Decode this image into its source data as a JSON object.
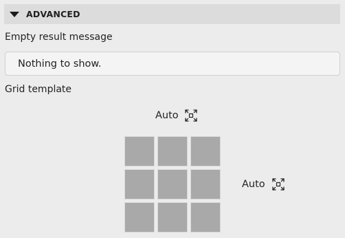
{
  "section": {
    "title": "ADVANCED"
  },
  "empty_result": {
    "label": "Empty result message",
    "value": "Nothing to show."
  },
  "grid_template": {
    "label": "Grid template",
    "columns_label": "Auto",
    "rows_label": "Auto",
    "columns_icon": "expand-icon",
    "rows_icon": "expand-icon",
    "cells": [
      {
        "name": "cell-1"
      },
      {
        "name": "cell-2"
      },
      {
        "name": "cell-3"
      },
      {
        "name": "cell-4"
      },
      {
        "name": "cell-5"
      },
      {
        "name": "cell-6"
      },
      {
        "name": "cell-7"
      },
      {
        "name": "cell-8"
      },
      {
        "name": "cell-9"
      }
    ]
  },
  "colors": {
    "background": "#ececec",
    "header": "#dcdcdc",
    "cell": "#a9a9a9"
  }
}
